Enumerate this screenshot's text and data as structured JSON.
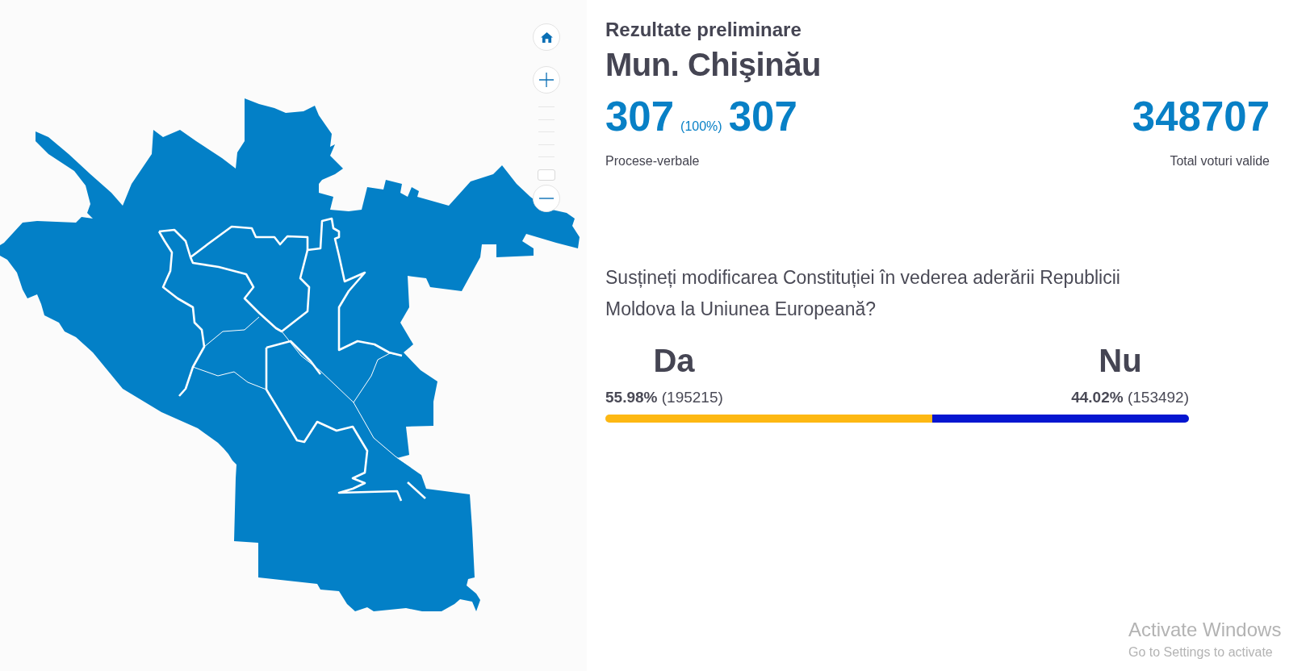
{
  "map_controls": {
    "zoom_slider": {
      "level": 0
    }
  },
  "header": {
    "subtitle": "Rezultate preliminare",
    "title": "Mun. Chişinău"
  },
  "counted_reports": {
    "value": "307",
    "percent": "(100%)",
    "total": "307",
    "label": "Procese-verbale"
  },
  "valid_votes": {
    "value": "348707",
    "label": "Total voturi valide"
  },
  "question": "Susțineți modificarea Constituției în vederea aderării Republicii Moldova la Uniunea Europeană?",
  "results": [
    {
      "label": "Da",
      "share": "**55.98%** (195215)",
      "color": "#fdb813",
      "level": 0.5598
    },
    {
      "label": "Nu",
      "share": "**44.02%** (153492)",
      "color": "#0516d0",
      "level": 0.4402
    }
  ],
  "os_overlay": {
    "title": "Activate Windows",
    "message": "Go to Settings to activate"
  }
}
